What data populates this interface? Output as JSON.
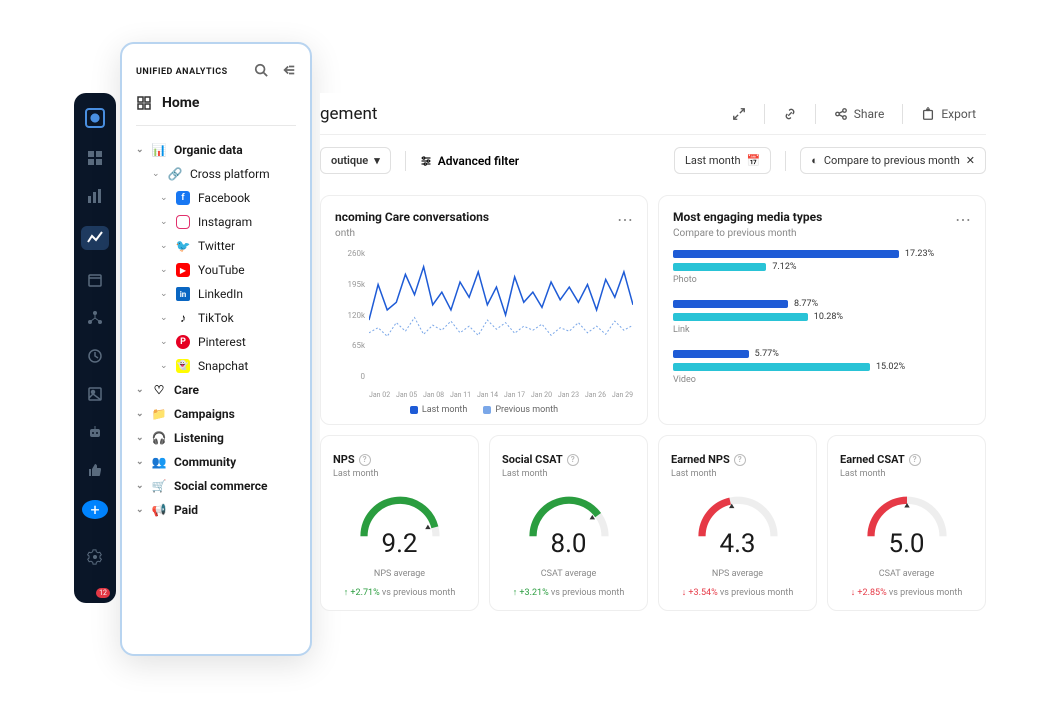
{
  "panel": {
    "title": "UNIFIED ANALYTICS",
    "home": "Home",
    "tree": {
      "organic": "Organic data",
      "cross": "Cross platform",
      "facebook": "Facebook",
      "instagram": "Instagram",
      "twitter": "Twitter",
      "youtube": "YouTube",
      "linkedin": "LinkedIn",
      "tiktok": "TikTok",
      "pinterest": "Pinterest",
      "snapchat": "Snapchat",
      "care": "Care",
      "campaigns": "Campaigns",
      "listening": "Listening",
      "community": "Community",
      "social_commerce": "Social commerce",
      "paid": "Paid"
    }
  },
  "rail": {
    "badge": "12"
  },
  "header": {
    "title": "gement",
    "share": "Share",
    "export": "Export"
  },
  "filters": {
    "profile": "outique",
    "advanced": "Advanced filter",
    "period": "Last month",
    "compare": "Compare to previous month"
  },
  "chart1": {
    "title": "ncoming Care conversations",
    "sub": "onth",
    "legend_current": "Last month",
    "legend_prev": "Previous month"
  },
  "chart2": {
    "title": "Most engaging media types",
    "sub": "Compare to previous month",
    "photo": "Photo",
    "link": "Link",
    "video": "Video"
  },
  "metrics": [
    {
      "title": "NPS",
      "sub": "Last month",
      "val": "9.2",
      "avg": "NPS average",
      "change": "+2.71%",
      "rest": "vs previous month",
      "dir": "up"
    },
    {
      "title": "Social CSAT",
      "sub": "Last month",
      "val": "8.0",
      "avg": "CSAT average",
      "change": "+3.21%",
      "rest": "vs previous month",
      "dir": "up"
    },
    {
      "title": "Earned NPS",
      "sub": "Last month",
      "val": "4.3",
      "avg": "NPS average",
      "change": "+3.54%",
      "rest": "vs previous month",
      "dir": "down"
    },
    {
      "title": "Earned CSAT",
      "sub": "Last month",
      "val": "5.0",
      "avg": "CSAT average",
      "change": "+2.85%",
      "rest": "vs previous month",
      "dir": "down"
    }
  ],
  "chart_data": [
    {
      "type": "line",
      "title": "Incoming Care conversations",
      "xlabel": "",
      "ylabel": "",
      "ylim": [
        0,
        260000
      ],
      "y_ticks": [
        "260k",
        "195k",
        "120k",
        "65k",
        "0"
      ],
      "x_ticks": [
        "Jan 02",
        "Jan 05",
        "Jan 08",
        "Jan 11",
        "Jan 14",
        "Jan 17",
        "Jan 20",
        "Jan 23",
        "Jan 26",
        "Jan 29"
      ],
      "series": [
        {
          "name": "Last month",
          "color": "#1e5bd6",
          "values": [
            120000,
            190000,
            140000,
            155000,
            210000,
            170000,
            225000,
            150000,
            175000,
            140000,
            195000,
            165000,
            215000,
            150000,
            185000,
            130000,
            205000,
            155000,
            175000,
            145000,
            195000,
            160000,
            185000,
            155000,
            190000,
            140000,
            200000,
            165000,
            215000,
            150000
          ]
        },
        {
          "name": "Previous month",
          "color": "#7aa7e8",
          "values": [
            95000,
            105000,
            88000,
            115000,
            98000,
            125000,
            92000,
            110000,
            100000,
            118000,
            95000,
            108000,
            90000,
            120000,
            102000,
            115000,
            94000,
            108000,
            100000,
            112000,
            90000,
            105000,
            98000,
            115000,
            95000,
            108000,
            92000,
            118000,
            100000,
            110000
          ]
        }
      ]
    },
    {
      "type": "bar",
      "title": "Most engaging media types",
      "categories": [
        "Photo",
        "Link",
        "Video"
      ],
      "series": [
        {
          "name": "Last month",
          "color": "#1e5bd6",
          "values": [
            17.23,
            8.77,
            5.77
          ]
        },
        {
          "name": "Previous month",
          "color": "#29c3d6",
          "values": [
            7.12,
            10.28,
            15.02
          ]
        }
      ],
      "value_suffix": "%"
    }
  ]
}
